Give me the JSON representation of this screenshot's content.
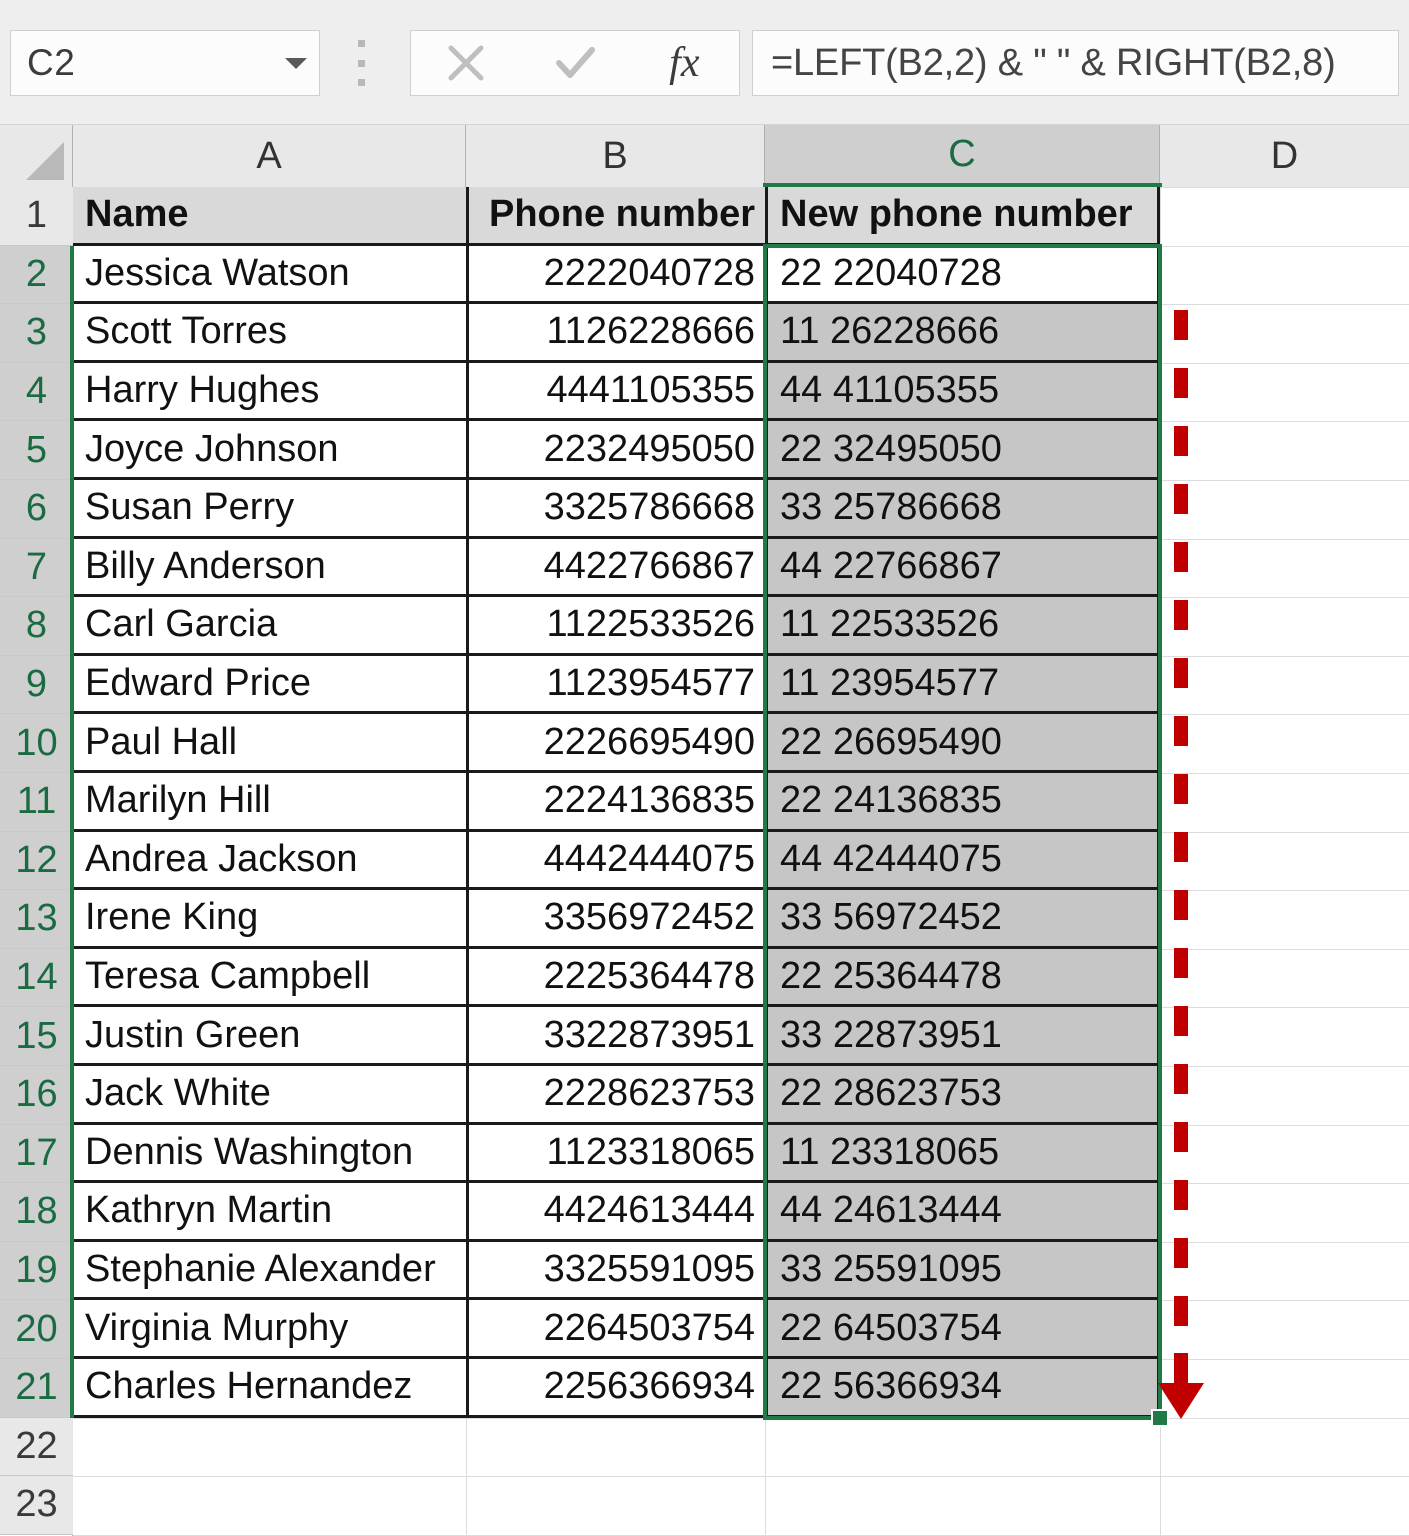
{
  "formula_bar": {
    "name_box_value": "C2",
    "cancel_icon": "close-icon",
    "enter_icon": "check-icon",
    "function_icon": "fx-icon",
    "function_label": "fx",
    "formula_value": "=LEFT(B2,2) & \" \" & RIGHT(B2,8)",
    "formula_placeholder": ""
  },
  "sheet": {
    "columns": [
      {
        "letter": "A",
        "selected": false
      },
      {
        "letter": "B",
        "selected": false
      },
      {
        "letter": "C",
        "selected": true
      },
      {
        "letter": "D",
        "selected": false
      }
    ],
    "rows": [
      {
        "num": "1",
        "selected": false
      },
      {
        "num": "2",
        "selected": true
      },
      {
        "num": "3",
        "selected": true
      },
      {
        "num": "4",
        "selected": true
      },
      {
        "num": "5",
        "selected": true
      },
      {
        "num": "6",
        "selected": true
      },
      {
        "num": "7",
        "selected": true
      },
      {
        "num": "8",
        "selected": true
      },
      {
        "num": "9",
        "selected": true
      },
      {
        "num": "10",
        "selected": true
      },
      {
        "num": "11",
        "selected": true
      },
      {
        "num": "12",
        "selected": true
      },
      {
        "num": "13",
        "selected": true
      },
      {
        "num": "14",
        "selected": true
      },
      {
        "num": "15",
        "selected": true
      },
      {
        "num": "16",
        "selected": true
      },
      {
        "num": "17",
        "selected": true
      },
      {
        "num": "18",
        "selected": true
      },
      {
        "num": "19",
        "selected": true
      },
      {
        "num": "20",
        "selected": true
      },
      {
        "num": "21",
        "selected": true
      },
      {
        "num": "22",
        "selected": false
      },
      {
        "num": "23",
        "selected": false
      }
    ],
    "headers": {
      "name": "Name",
      "phone": "Phone number",
      "new_phone": "New phone number"
    },
    "data": [
      {
        "name": "Jessica Watson",
        "phone": "2222040728",
        "new_phone": "22 22040728"
      },
      {
        "name": "Scott Torres",
        "phone": "1126228666",
        "new_phone": "11 26228666"
      },
      {
        "name": "Harry Hughes",
        "phone": "4441105355",
        "new_phone": "44 41105355"
      },
      {
        "name": "Joyce Johnson",
        "phone": "2232495050",
        "new_phone": "22 32495050"
      },
      {
        "name": "Susan Perry",
        "phone": "3325786668",
        "new_phone": "33 25786668"
      },
      {
        "name": "Billy Anderson",
        "phone": "4422766867",
        "new_phone": "44 22766867"
      },
      {
        "name": "Carl Garcia",
        "phone": "1122533526",
        "new_phone": "11 22533526"
      },
      {
        "name": "Edward Price",
        "phone": "1123954577",
        "new_phone": "11 23954577"
      },
      {
        "name": "Paul Hall",
        "phone": "2226695490",
        "new_phone": "22 26695490"
      },
      {
        "name": "Marilyn Hill",
        "phone": "2224136835",
        "new_phone": "22 24136835"
      },
      {
        "name": "Andrea Jackson",
        "phone": "4442444075",
        "new_phone": "44 42444075"
      },
      {
        "name": "Irene King",
        "phone": "3356972452",
        "new_phone": "33 56972452"
      },
      {
        "name": "Teresa Campbell",
        "phone": "2225364478",
        "new_phone": "22 25364478"
      },
      {
        "name": "Justin Green",
        "phone": "3322873951",
        "new_phone": "33 22873951"
      },
      {
        "name": "Jack White",
        "phone": "2228623753",
        "new_phone": "22 28623753"
      },
      {
        "name": "Dennis Washington",
        "phone": "1123318065",
        "new_phone": "11 23318065"
      },
      {
        "name": "Kathryn Martin",
        "phone": "4424613444",
        "new_phone": "44 24613444"
      },
      {
        "name": "Stephanie Alexander",
        "phone": "3325591095",
        "new_phone": "33 25591095"
      },
      {
        "name": "Virginia Murphy",
        "phone": "2264503754",
        "new_phone": "22 64503754"
      },
      {
        "name": "Charles Hernandez",
        "phone": "2256366934",
        "new_phone": "22 56366934"
      }
    ],
    "selection": {
      "active_cell": "C2",
      "range": "C2:C21",
      "border_color": "#1f7a47",
      "fill_color": "#c6c6c6"
    }
  },
  "annotation": {
    "type": "down-arrow",
    "style": "dashed",
    "color": "#C00000"
  }
}
